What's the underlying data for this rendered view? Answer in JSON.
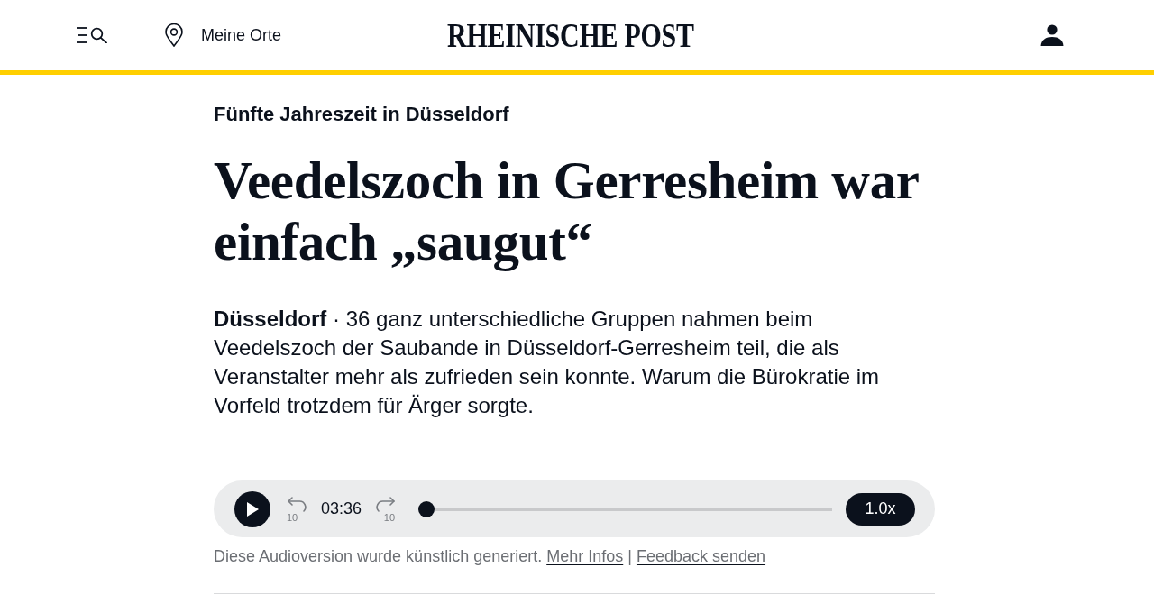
{
  "header": {
    "places_link": "Meine Orte",
    "logo": "RHEINISCHE POST"
  },
  "article": {
    "kicker": "Fünfte Jahreszeit in Düsseldorf",
    "headline": "Veedelszoch in Gerresheim war einfach „saugut“",
    "lead": "**Düsseldorf** · 36 ganz unterschiedliche Gruppen nahmen beim Veedelszoch der Saubande in Düsseldorf-Gerresheim teil, die als Veranstalter mehr als zufrieden sein konnte. Warum die Bürokratie im Vorfeld trotzdem für Ärger sorgte."
  },
  "audio_player": {
    "playing": false,
    "skip_back": "10",
    "time": "03:36",
    "skip_forward": "10",
    "level": 0,
    "speed": "1.0x"
  },
  "audio_note": {
    "text": "Diese Audioversion wurde künstlich generiert.",
    "links": [
      "Mehr Infos",
      "Feedback senden"
    ],
    "separator": "|"
  }
}
